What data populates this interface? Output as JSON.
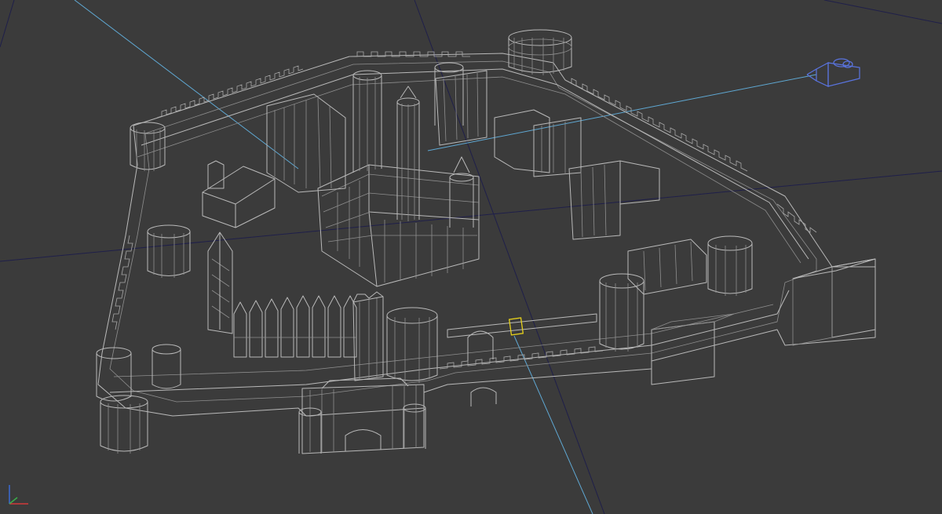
{
  "viewport": {
    "background_color": "#3b3b3b",
    "wireframe_color": "#b9b9b9",
    "camera_color": "#5a74e0",
    "camera_line_color": "#5fa8d3",
    "grid_axis_color": "#1f1f4a",
    "selected_pivot_color": "#e6d11b"
  },
  "axis_gizmo": {
    "x_color": "#d23a3a",
    "y_color": "#3ab04a",
    "z_color": "#3a6ad2"
  }
}
